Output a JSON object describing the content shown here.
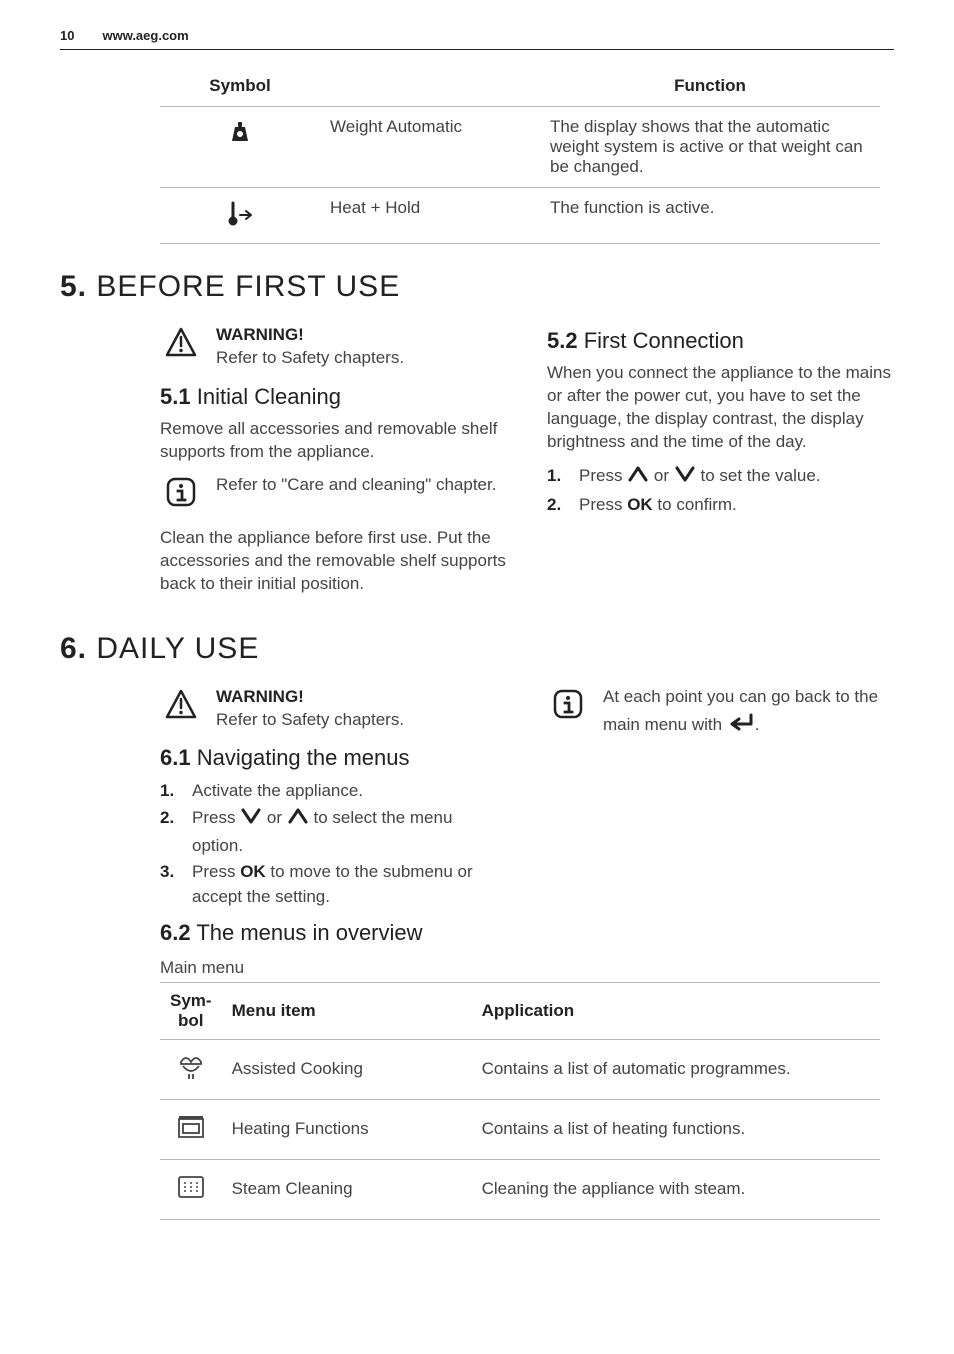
{
  "header": {
    "page_number": "10",
    "url": "www.aeg.com"
  },
  "symbol_table": {
    "headers": {
      "symbol": "Symbol",
      "function": "Function"
    },
    "rows": [
      {
        "icon": "weight-icon",
        "name": "Weight Automatic",
        "desc": "The display shows that the automatic weight system is active or that weight can be changed."
      },
      {
        "icon": "heat-hold-icon",
        "name": "Heat + Hold",
        "desc": "The function is active."
      }
    ]
  },
  "sections": {
    "s5": {
      "num": "5.",
      "title": "BEFORE FIRST USE"
    },
    "s6": {
      "num": "6.",
      "title": "DAILY USE"
    }
  },
  "warning": {
    "title": "WARNING!",
    "text": "Refer to Safety chapters."
  },
  "s5_1": {
    "num": "5.1",
    "title": "Initial Cleaning",
    "p1": "Remove all accessories and removable shelf supports from the appliance.",
    "info": "Refer to \"Care and cleaning\" chapter.",
    "p2": "Clean the appliance before first use. Put the accessories and the removable shelf supports back to their initial position."
  },
  "s5_2": {
    "num": "5.2",
    "title": "First Connection",
    "p1": "When you connect the appliance to the mains or after the power cut, you have to set the language, the display contrast, the display brightness and the time of the day.",
    "step1_a": "Press ",
    "step1_b": " or ",
    "step1_c": " to set the value.",
    "step2_a": "Press ",
    "step2_b": " to confirm.",
    "ok": "OK"
  },
  "s6_1": {
    "num": "6.1",
    "title": "Navigating the menus",
    "step1": "Activate the appliance.",
    "step2_a": "Press ",
    "step2_b": " or ",
    "step2_c": " to select the menu option.",
    "step3_a": "Press ",
    "step3_b": " to move to the submenu or accept the setting.",
    "ok": "OK"
  },
  "s6_info": {
    "text_a": "At each point you can go back to the main menu with ",
    "text_b": "."
  },
  "s6_2": {
    "num": "6.2",
    "title": "The menus in overview",
    "subtitle": "Main menu",
    "headers": {
      "symbol": "Sym-\nbol",
      "menu_item": "Menu item",
      "application": "Application"
    },
    "rows": [
      {
        "icon": "assisted-cooking-icon",
        "item": "Assisted Cooking",
        "app": "Contains a list of automatic programmes."
      },
      {
        "icon": "heating-functions-icon",
        "item": "Heating Functions",
        "app": "Contains a list of heating functions."
      },
      {
        "icon": "steam-cleaning-icon",
        "item": "Steam Cleaning",
        "app": "Cleaning the appliance with steam."
      }
    ]
  },
  "nums": {
    "1": "1.",
    "2": "2.",
    "3": "3."
  }
}
